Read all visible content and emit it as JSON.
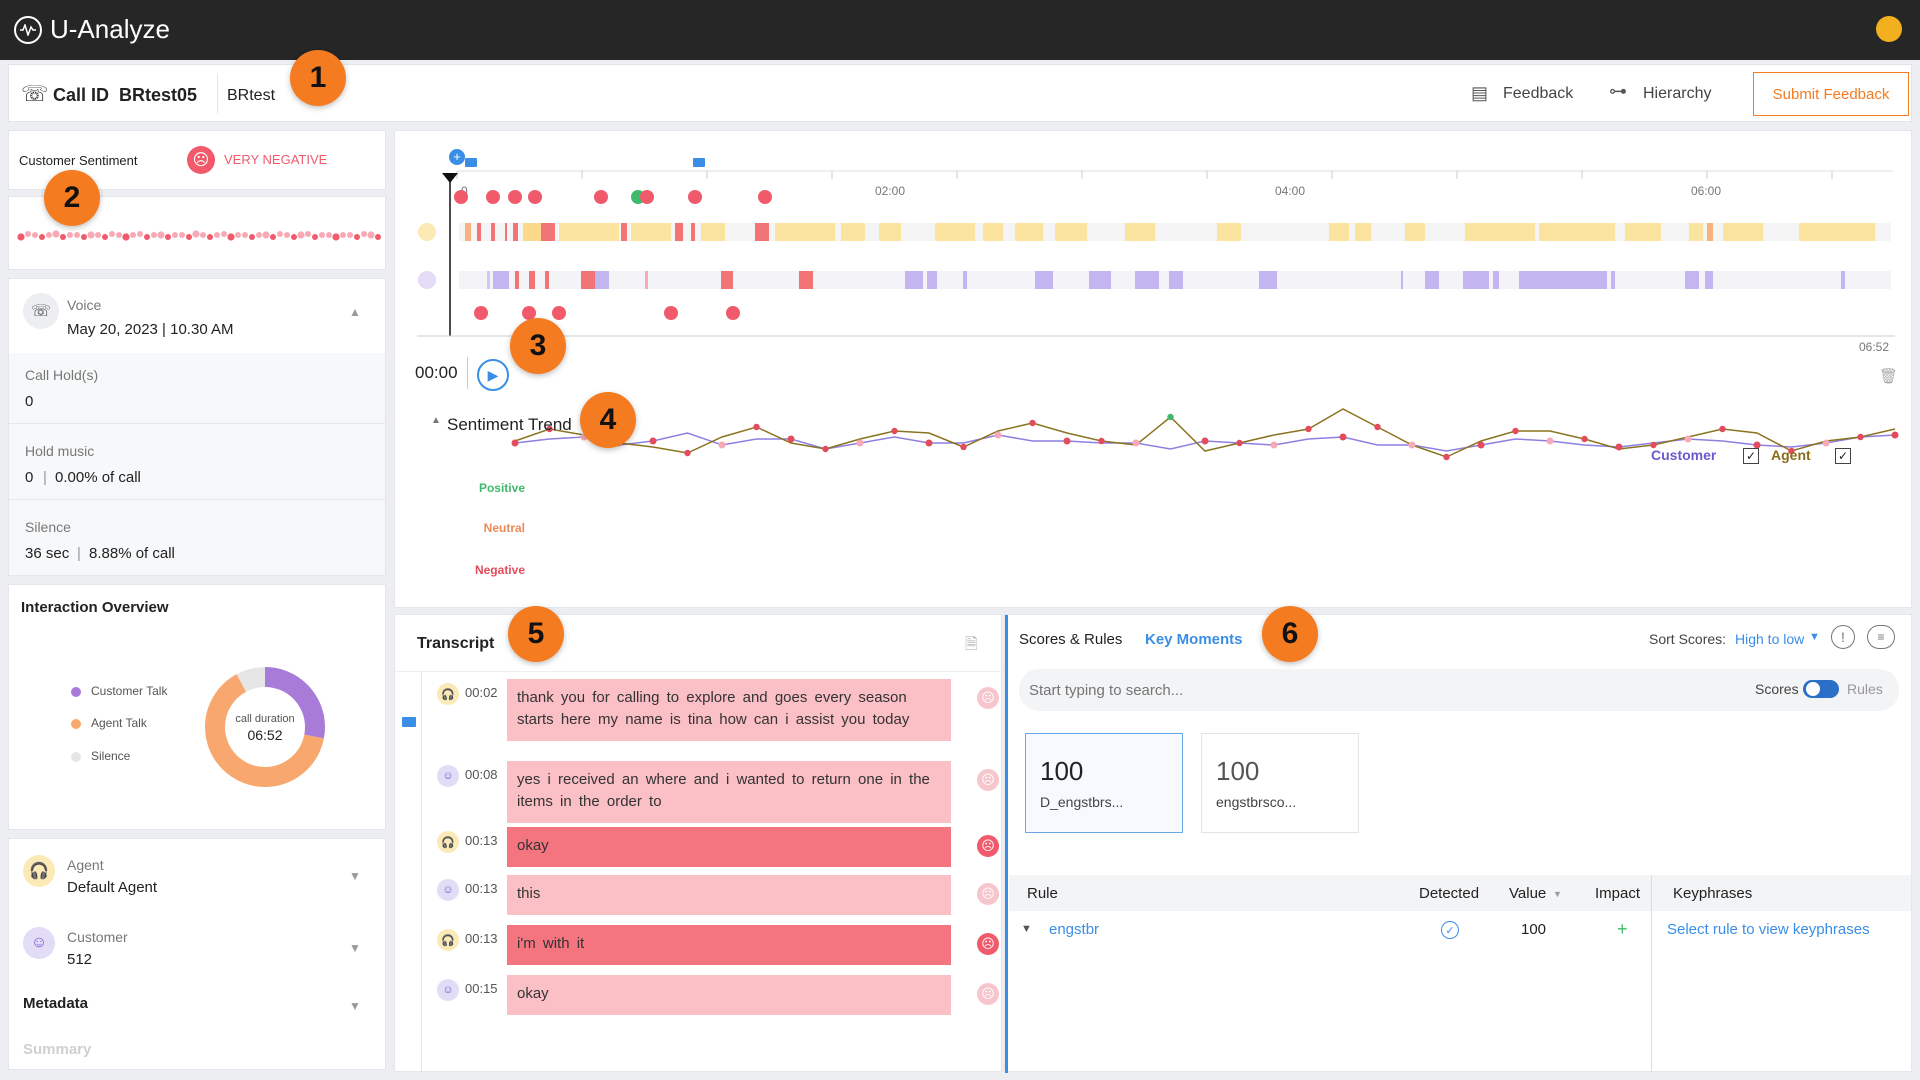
{
  "app": {
    "title": "U-Analyze"
  },
  "callbar": {
    "call_id_label": "Call ID",
    "call_id": "BRtest05",
    "tag": "BRtest",
    "feedback": "Feedback",
    "hierarchy": "Hierarchy",
    "submit": "Submit Feedback"
  },
  "badges": [
    "1",
    "2",
    "3",
    "4",
    "5",
    "6"
  ],
  "sentiment": {
    "label": "Customer Sentiment",
    "value": "VERY NEGATIVE"
  },
  "call_info": {
    "channel": "Voice",
    "date": "May 20, 2023 | 10.30 AM",
    "hold_label": "Call Hold(s)",
    "hold_value": "0",
    "music_label": "Hold music",
    "music_value": "0",
    "music_pct": "0.00% of call",
    "silence_label": "Silence",
    "silence_value": "36 sec",
    "silence_pct": "8.88% of call"
  },
  "overview": {
    "title": "Interaction Overview",
    "legend": [
      "Customer Talk",
      "Agent Talk",
      "Silence"
    ],
    "center_label": "call duration",
    "center_value": "06:52",
    "share": {
      "customer": 0.28,
      "agent": 0.64,
      "silence": 0.08
    },
    "colors": {
      "customer": "#a87bd8",
      "agent": "#f8a86e",
      "silence": "#e6e6e6"
    }
  },
  "people": {
    "agent_label": "Agent",
    "agent_name": "Default Agent",
    "customer_label": "Customer",
    "customer_name": "512",
    "metadata": "Metadata",
    "summary": "Summary"
  },
  "timeline": {
    "ticks": [
      "0",
      "02:00",
      "04:00",
      "06:00"
    ],
    "end_time": "06:52",
    "current_time": "00:00"
  },
  "trend": {
    "title": "Sentiment Trend",
    "customer": "Customer",
    "agent": "Agent",
    "positive": "Positive",
    "neutral": "Neutral",
    "negative": "Negative"
  },
  "transcript": {
    "title": "Transcript",
    "rows": [
      {
        "time": "00:02",
        "speaker": "agent",
        "text": "thank you for calling to explore and goes every season starts here my name is tina how can i assist you today",
        "level": "light"
      },
      {
        "time": "00:08",
        "speaker": "customer",
        "text": "yes i received an where and i wanted to return one in the items in the order to",
        "level": "light"
      },
      {
        "time": "00:13",
        "speaker": "agent",
        "text": "okay",
        "level": "strong"
      },
      {
        "time": "00:13",
        "speaker": "customer",
        "text": "this",
        "level": "light"
      },
      {
        "time": "00:13",
        "speaker": "agent",
        "text": "i'm with it",
        "level": "strong"
      },
      {
        "time": "00:15",
        "speaker": "customer",
        "text": "okay",
        "level": "light"
      }
    ]
  },
  "scores": {
    "tab_scores": "Scores & Rules",
    "tab_moments": "Key Moments",
    "sort_label": "Sort Scores:",
    "sort_value": "High to low",
    "search_placeholder": "Start typing to search...",
    "toggle_left": "Scores",
    "toggle_right": "Rules",
    "cards": [
      {
        "value": "100",
        "name": "D_engstbrs..."
      },
      {
        "value": "100",
        "name": "engstbrsco..."
      }
    ],
    "headers": {
      "rule": "Rule",
      "detected": "Detected",
      "value": "Value",
      "impact": "Impact",
      "keyphrases": "Keyphrases"
    },
    "row": {
      "rule": "engstbr",
      "value": "100",
      "impact": "+"
    },
    "keyphrase_hint": "Select rule to view keyphrases"
  }
}
